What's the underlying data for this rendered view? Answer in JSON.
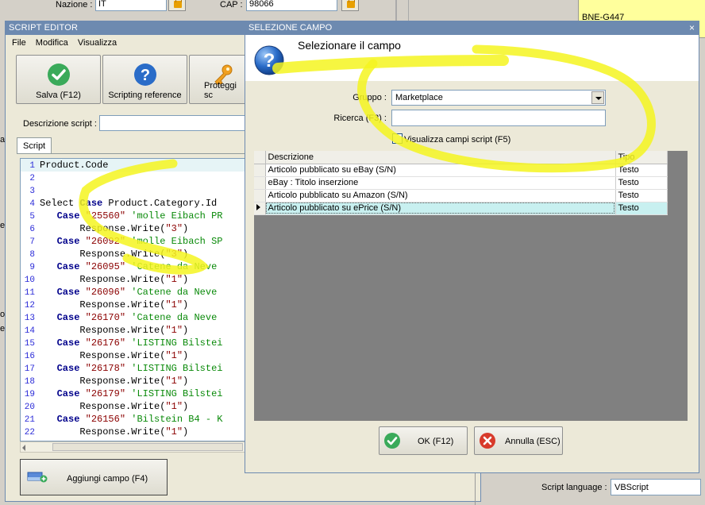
{
  "background": {
    "nazione_label": "Nazione :",
    "nazione_value": "IT",
    "cap_label": "CAP :",
    "cap_value": "98066",
    "code_label": "BNE-G447",
    "edge_letters": [
      "a'",
      "e",
      "o",
      "er"
    ]
  },
  "editor": {
    "title": "SCRIPT EDITOR",
    "menu": [
      "File",
      "Modifica",
      "Visualizza"
    ],
    "toolbar": {
      "save_label": "Salva (F12)",
      "reference_label": "Scripting reference",
      "protect_label": "Proteggi sc"
    },
    "description_label": "Descrizione script :",
    "tab_label": "Script",
    "code_lines": [
      {
        "n": "1",
        "parts": [
          {
            "t": "Product.Code",
            "c": "plain"
          }
        ]
      },
      {
        "n": "2",
        "parts": []
      },
      {
        "n": "3",
        "parts": []
      },
      {
        "n": "4",
        "parts": [
          {
            "t": "Select ",
            "c": "plain"
          },
          {
            "t": "Case",
            "c": "kw"
          },
          {
            "t": " Product.Category.Id",
            "c": "plain"
          }
        ]
      },
      {
        "n": "5",
        "parts": [
          {
            "t": "   ",
            "c": "plain"
          },
          {
            "t": "Case",
            "c": "kw"
          },
          {
            "t": " ",
            "c": "plain"
          },
          {
            "t": "\"25560\"",
            "c": "str"
          },
          {
            "t": " 'molle Eibach PR",
            "c": "cmt"
          }
        ]
      },
      {
        "n": "6",
        "parts": [
          {
            "t": "       Response.Write(",
            "c": "plain"
          },
          {
            "t": "\"3\"",
            "c": "str"
          },
          {
            "t": ")",
            "c": "plain"
          }
        ]
      },
      {
        "n": "7",
        "parts": [
          {
            "t": "   ",
            "c": "plain"
          },
          {
            "t": "Case",
            "c": "kw"
          },
          {
            "t": " ",
            "c": "plain"
          },
          {
            "t": "\"26092\"",
            "c": "str"
          },
          {
            "t": " 'molle Eibach SP",
            "c": "cmt"
          }
        ]
      },
      {
        "n": "8",
        "parts": [
          {
            "t": "       Response.Write(",
            "c": "plain"
          },
          {
            "t": "\"3\"",
            "c": "str"
          },
          {
            "t": ")",
            "c": "plain"
          }
        ]
      },
      {
        "n": "9",
        "parts": [
          {
            "t": "   ",
            "c": "plain"
          },
          {
            "t": "Case",
            "c": "kw"
          },
          {
            "t": " ",
            "c": "plain"
          },
          {
            "t": "\"26095\"",
            "c": "str"
          },
          {
            "t": " 'Catene da Neve",
            "c": "cmt"
          }
        ]
      },
      {
        "n": "10",
        "parts": [
          {
            "t": "       Response.Write(",
            "c": "plain"
          },
          {
            "t": "\"1\"",
            "c": "str"
          },
          {
            "t": ")",
            "c": "plain"
          }
        ]
      },
      {
        "n": "11",
        "parts": [
          {
            "t": "   ",
            "c": "plain"
          },
          {
            "t": "Case",
            "c": "kw"
          },
          {
            "t": " ",
            "c": "plain"
          },
          {
            "t": "\"26096\"",
            "c": "str"
          },
          {
            "t": " 'Catene da Neve",
            "c": "cmt"
          }
        ]
      },
      {
        "n": "12",
        "parts": [
          {
            "t": "       Response.Write(",
            "c": "plain"
          },
          {
            "t": "\"1\"",
            "c": "str"
          },
          {
            "t": ")",
            "c": "plain"
          }
        ]
      },
      {
        "n": "13",
        "parts": [
          {
            "t": "   ",
            "c": "plain"
          },
          {
            "t": "Case",
            "c": "kw"
          },
          {
            "t": " ",
            "c": "plain"
          },
          {
            "t": "\"26170\"",
            "c": "str"
          },
          {
            "t": " 'Catene da Neve",
            "c": "cmt"
          }
        ]
      },
      {
        "n": "14",
        "parts": [
          {
            "t": "       Response.Write(",
            "c": "plain"
          },
          {
            "t": "\"1\"",
            "c": "str"
          },
          {
            "t": ")",
            "c": "plain"
          }
        ]
      },
      {
        "n": "15",
        "parts": [
          {
            "t": "   ",
            "c": "plain"
          },
          {
            "t": "Case",
            "c": "kw"
          },
          {
            "t": " ",
            "c": "plain"
          },
          {
            "t": "\"26176\"",
            "c": "str"
          },
          {
            "t": " 'LISTING Bilstei",
            "c": "cmt"
          }
        ]
      },
      {
        "n": "16",
        "parts": [
          {
            "t": "       Response.Write(",
            "c": "plain"
          },
          {
            "t": "\"1\"",
            "c": "str"
          },
          {
            "t": ")",
            "c": "plain"
          }
        ]
      },
      {
        "n": "17",
        "parts": [
          {
            "t": "   ",
            "c": "plain"
          },
          {
            "t": "Case",
            "c": "kw"
          },
          {
            "t": " ",
            "c": "plain"
          },
          {
            "t": "\"26178\"",
            "c": "str"
          },
          {
            "t": " 'LISTING Bilstei",
            "c": "cmt"
          }
        ]
      },
      {
        "n": "18",
        "parts": [
          {
            "t": "       Response.Write(",
            "c": "plain"
          },
          {
            "t": "\"1\"",
            "c": "str"
          },
          {
            "t": ")",
            "c": "plain"
          }
        ]
      },
      {
        "n": "19",
        "parts": [
          {
            "t": "   ",
            "c": "plain"
          },
          {
            "t": "Case",
            "c": "kw"
          },
          {
            "t": " ",
            "c": "plain"
          },
          {
            "t": "\"26179\"",
            "c": "str"
          },
          {
            "t": " 'LISTING Bilstei",
            "c": "cmt"
          }
        ]
      },
      {
        "n": "20",
        "parts": [
          {
            "t": "       Response.Write(",
            "c": "plain"
          },
          {
            "t": "\"1\"",
            "c": "str"
          },
          {
            "t": ")",
            "c": "plain"
          }
        ]
      },
      {
        "n": "21",
        "parts": [
          {
            "t": "   ",
            "c": "plain"
          },
          {
            "t": "Case",
            "c": "kw"
          },
          {
            "t": " ",
            "c": "plain"
          },
          {
            "t": "\"26156\"",
            "c": "str"
          },
          {
            "t": " 'Bilstein B4 - K",
            "c": "cmt"
          }
        ]
      },
      {
        "n": "22",
        "parts": [
          {
            "t": "       Response.Write(",
            "c": "plain"
          },
          {
            "t": "\"1\"",
            "c": "str"
          },
          {
            "t": ")",
            "c": "plain"
          }
        ]
      }
    ],
    "add_field_label": "Aggiungi campo (F4)",
    "script_language_label": "Script language :",
    "script_language_value": "VBScript"
  },
  "dialog": {
    "title": "SELEZIONE CAMPO",
    "close_glyph": "×",
    "heading": "Selezionare il campo",
    "group_label": "Gruppo :",
    "group_value": "Marketplace",
    "search_label": "Ricerca (F3) :",
    "search_value": "",
    "checkbox_label": "Visualizza campi script (F5)",
    "checkbox_checked": false,
    "columns": [
      "Descrizione",
      "Tipo"
    ],
    "rows": [
      {
        "descrizione": "Articolo pubblicato su eBay (S/N)",
        "tipo": "Testo",
        "active": false
      },
      {
        "descrizione": "eBay : Titolo inserzione",
        "tipo": "Testo",
        "active": false
      },
      {
        "descrizione": "Articolo pubblicato su Amazon (S/N)",
        "tipo": "Testo",
        "active": false
      },
      {
        "descrizione": "Articolo pubblicato su ePrice (S/N)",
        "tipo": "Testo",
        "active": true
      }
    ],
    "ok_label": "OK (F12)",
    "cancel_label": "Annulla (ESC)"
  },
  "colors": {
    "titlebar": "#6d8ab0",
    "highlighter": "#f5f520",
    "active_row": "#c8f0f0",
    "ok_green": "#3aaa5a",
    "cancel_red": "#d83a2a",
    "info_blue": "#2a6cc8"
  }
}
